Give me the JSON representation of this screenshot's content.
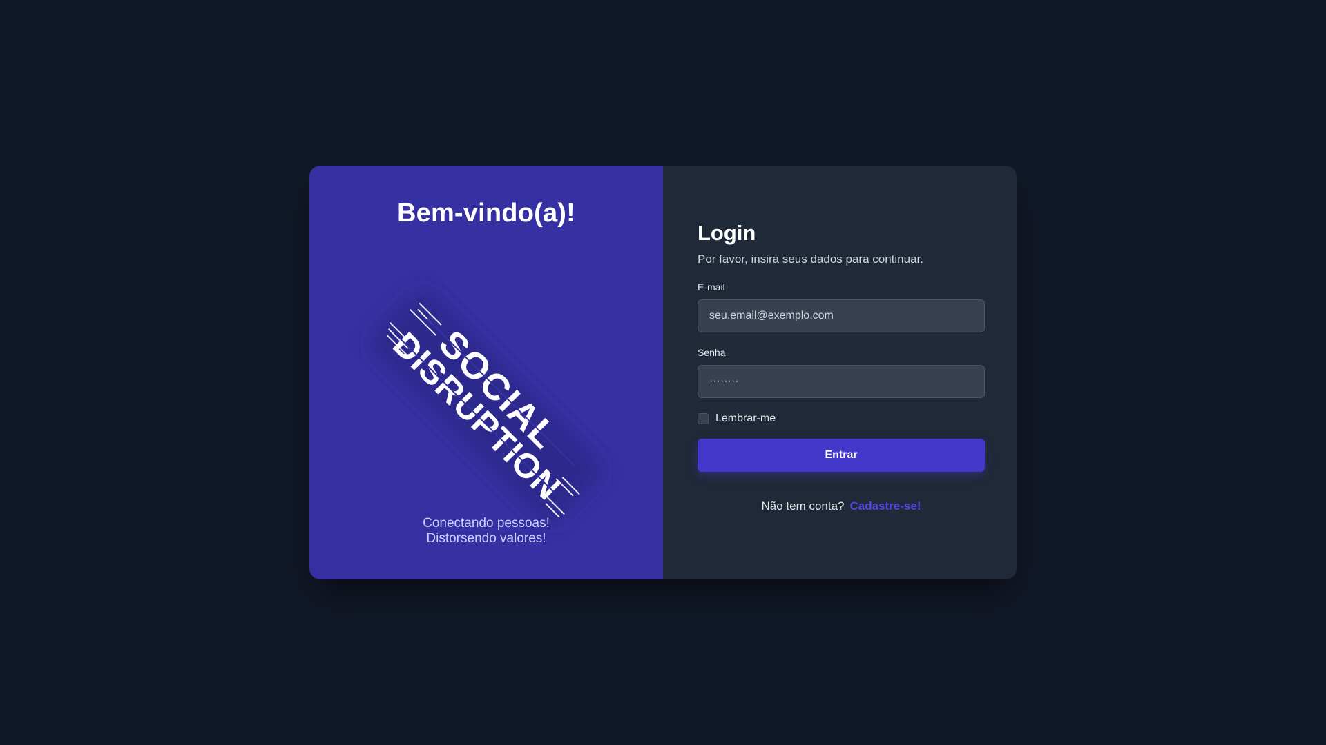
{
  "left_panel": {
    "heading": "Bem-vindo(a)!",
    "logo_line1": "SOCIAL",
    "logo_line2": "DISRUPTION",
    "tagline_line1": "Conectando pessoas!",
    "tagline_line2": "Distorsendo valores!"
  },
  "login": {
    "title": "Login",
    "subtitle": "Por favor, insira seus dados para continuar.",
    "email_label": "E-mail",
    "email_placeholder": "seu.email@exemplo.com",
    "password_label": "Senha",
    "password_value": "········",
    "remember_label": "Lembrar-me",
    "submit_label": "Entrar",
    "no_account_text": "Não tem conta?",
    "signup_link": "Cadastre-se!"
  },
  "colors": {
    "page_bg": "#111827",
    "left_bg": "#3730a3",
    "right_bg": "#1f2937",
    "accent": "#4338ca",
    "link": "#4f46e5"
  }
}
